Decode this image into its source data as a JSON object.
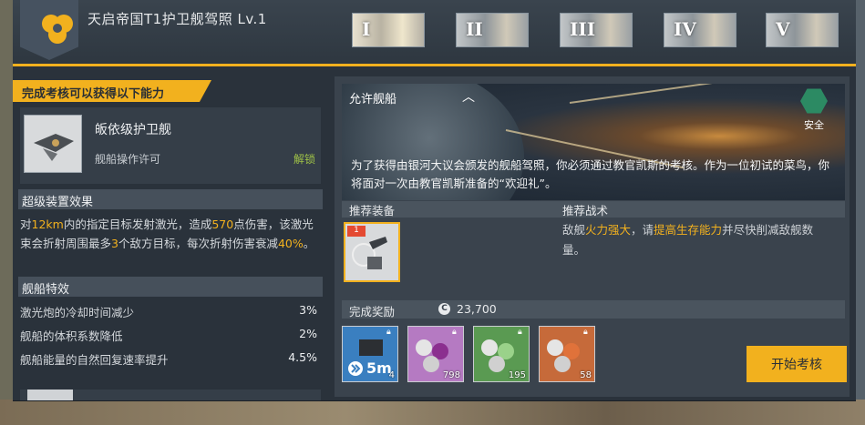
{
  "header": {
    "title": "天启帝国T1护卫舰驾照 Lv.1",
    "tiers": [
      "I",
      "II",
      "III",
      "IV",
      "V"
    ],
    "active_tier": "I"
  },
  "left": {
    "banner": "完成考核可以获得以下能力",
    "ship": {
      "name": "皈依级护卫舰",
      "permission": "舰船操作许可",
      "status": "解锁"
    },
    "super_device": {
      "heading": "超级装置效果",
      "parts": [
        "对",
        "12km",
        "内的指定目标发射激光，造成",
        "570",
        "点伤害，该激光束会折射周围最多",
        "3",
        "个敌方目标，每次折射伤害衰减",
        "40%",
        "。"
      ]
    },
    "traits": {
      "heading": "舰船特效",
      "items": [
        {
          "label": "激光炮的冷却时间减少",
          "value": "3%"
        },
        {
          "label": "舰船的体积系数降低",
          "value": "2%"
        },
        {
          "label": "舰船能量的自然回复速率提升",
          "value": "4.5%"
        }
      ]
    }
  },
  "right": {
    "allowed_ships_label": "允许舰船",
    "safety_label": "安全",
    "description": "为了获得由银河大议会颁发的舰船驾照，你必须通过教官凯斯的考核。作为一位初试的菜鸟，你将面对一次由教官凯斯准备的“欢迎礼”。",
    "recommended_equipment_label": "推荐装备",
    "recommended_tactics_label": "推荐战术",
    "equipment_level": "1",
    "tactics_parts": [
      "敌舰",
      "火力强大",
      "，请",
      "提高生存能力",
      "并尽快削减敌舰数量。"
    ],
    "reward_label": "完成奖励",
    "reward_currency": "23,700",
    "reward_items": [
      {
        "name": "speedup-5m",
        "label": "5m",
        "count": "4",
        "color": "#3a7fc0"
      },
      {
        "name": "purple-ore",
        "count": "798",
        "color": "#b57ac2"
      },
      {
        "name": "green-ore",
        "count": "195",
        "color": "#5a9a52"
      },
      {
        "name": "orange-ore",
        "count": "58",
        "color": "#c66a3a"
      }
    ],
    "start_button": "开始考核"
  },
  "colors": {
    "accent": "#f2b11e",
    "panel": "#2a323b",
    "unlock": "#9fc247",
    "safe": "#2c8a63"
  }
}
